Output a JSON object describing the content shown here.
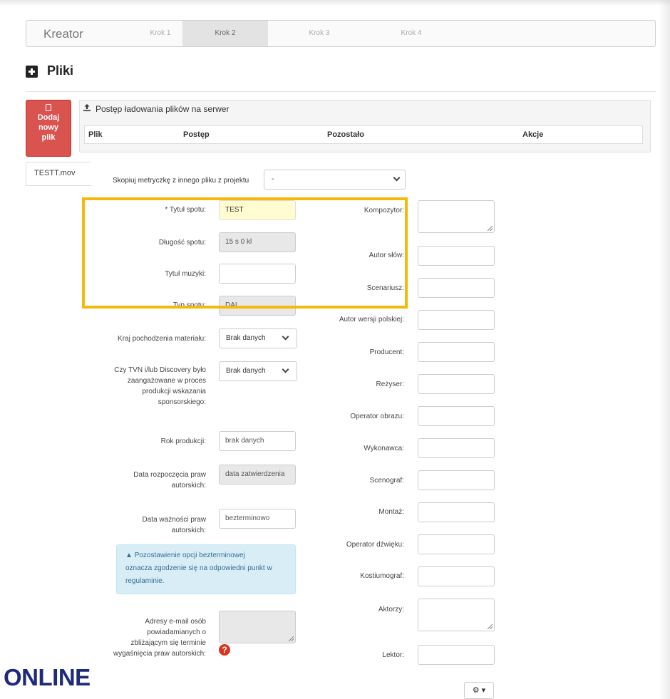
{
  "wizard": {
    "brand": "Kreator",
    "steps": [
      "Krok 1",
      "Krok 2",
      "Krok 3",
      "Krok 4"
    ]
  },
  "section": {
    "title": "Pliki",
    "icon": "plus-square-icon"
  },
  "add_button": {
    "line1": "Dodaj",
    "line2": "nowy",
    "line3": "plik",
    "icon": "file-icon"
  },
  "file_tab": "TESTT.mov",
  "upload": {
    "title": "Postęp ładowania plików na serwer",
    "icon": "upload-icon",
    "columns": [
      "Plik",
      "Postęp",
      "Pozostało",
      "Akcje"
    ]
  },
  "copy_metadata": {
    "label": "Skopiuj metryczkę z innego pliku z projektu",
    "value": "-"
  },
  "left_fields": {
    "tytul_spotu": {
      "label": "* Tytuł spotu:",
      "value": "TEST"
    },
    "dlugosc_spotu": {
      "label": "Długość spotu:",
      "value": "15 s 0 kl"
    },
    "tytul_muzyki": {
      "label": "Tytuł muzyki:",
      "value": ""
    },
    "typ_spotu": {
      "label": "Typ spotu:",
      "value": "DAI"
    },
    "kraj": {
      "label": "Kraj pochodzenia materiału:",
      "value": "Brak danych"
    },
    "tvn_line1": "Czy TVN i/lub Discovery było",
    "tvn_line2": "zaangażowane w proces",
    "tvn_line3": "produkcji wskazania",
    "tvn_line4": "sponsorskiego:",
    "tvn_value": "Brak danych",
    "rok": {
      "label": "Rok produkcji:",
      "value": "brak danych"
    },
    "data_rozp_line1": "Data rozpoczęcia praw",
    "data_rozp_line2": "autorskich:",
    "data_rozp_value": "data zatwierdzenia",
    "data_waz_line1": "Data ważności praw",
    "data_waz_line2": "autorskich:",
    "data_waz_value": "bezterminowo",
    "adresy_line1": "Adresy e-mail osób",
    "adresy_line2": "powiadamianych o",
    "adresy_line3": "zbliżającym się terminie",
    "adresy_line4": "wygaśnięcia praw autorskich:"
  },
  "alert": {
    "icon": "warning-icon",
    "line1": "Pozostawienie opcji bezterminowej",
    "line2": "oznacza zgodzenie się na odpowiedni punkt w",
    "line3": "regulaminie."
  },
  "right_fields": {
    "kompozytor": "Kompozytor:",
    "autor_slow": "Autor słów:",
    "scenariusz": "Scenariusz:",
    "autor_wersji": "Autor wersji polskiej:",
    "producent": "Producent:",
    "rezyser": "Reżyser:",
    "operator_obrazu": "Operator obrazu:",
    "wykonawca": "Wykonawca:",
    "scenograf": "Scenograf:",
    "montaz": "Montaż:",
    "operator_dzwieku": "Operator dźwięku:",
    "kostiumograf": "Kostiumograf:",
    "aktorzy": "Aktorzy:",
    "lektor": "Lektor:"
  },
  "help_icon_char": "?",
  "gear_button": {
    "icon": "gear-icon",
    "glyph": "⚙ ▾"
  },
  "watermark": "ONLINE",
  "colors": {
    "highlight": "#f6b80b",
    "danger": "#d9534f",
    "required_bg": "#fefcd0",
    "alert_bg": "#d9edf7",
    "watermark": "#1f2b7a"
  }
}
